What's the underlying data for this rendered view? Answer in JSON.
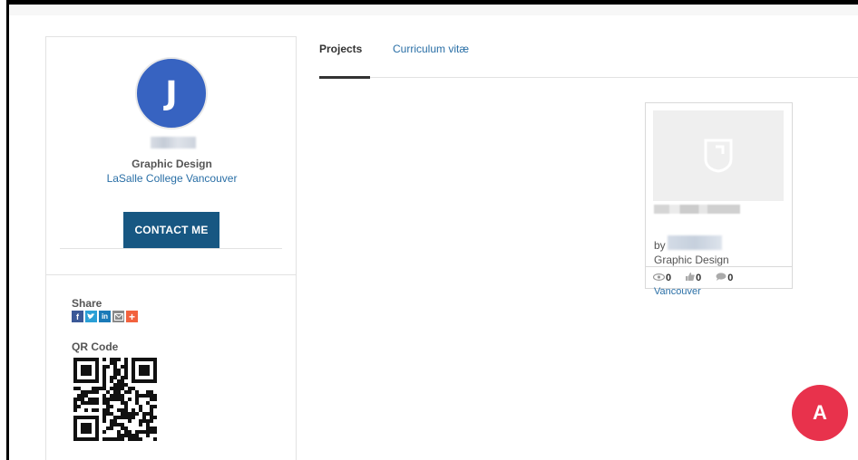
{
  "profile": {
    "avatar_initial": "J",
    "discipline": "Graphic Design",
    "school": "LaSalle College Vancouver",
    "contact_label": "CONTACT ME",
    "share_label": "Share",
    "share_icons": [
      "facebook-icon",
      "twitter-icon",
      "linkedin-icon",
      "email-icon",
      "more-icon"
    ],
    "qr_label": "QR Code"
  },
  "tabs": [
    {
      "label": "Projects",
      "active": true
    },
    {
      "label": "Curriculum vitæ",
      "active": false
    }
  ],
  "project_card": {
    "by_label": "by",
    "discipline": "Graphic Design",
    "views": "0",
    "likes": "0",
    "comments": "0",
    "overflow_text": "Vancouver"
  },
  "badge_label": "A",
  "colors": {
    "accent": "#175782",
    "link": "#2a6fa6",
    "avatar_bg": "#3763c1",
    "badge_bg": "#e8324c"
  }
}
